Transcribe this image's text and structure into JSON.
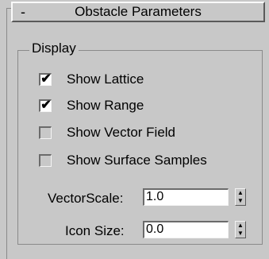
{
  "rollout": {
    "toggle": "-",
    "title": "Obstacle Parameters"
  },
  "display_group": {
    "legend": "Display",
    "checkboxes": [
      {
        "label": "Show Lattice",
        "checked": true
      },
      {
        "label": "Show Range",
        "checked": true
      },
      {
        "label": "Show Vector Field",
        "checked": false
      },
      {
        "label": "Show Surface Samples",
        "checked": false
      }
    ],
    "fields": {
      "vector_scale": {
        "label": "VectorScale:",
        "value": "1.0"
      },
      "icon_size": {
        "label": "Icon Size:",
        "value": "0.0"
      }
    }
  },
  "glyphs": {
    "check": "✔",
    "spin_up": "▲",
    "spin_down": "▼"
  }
}
